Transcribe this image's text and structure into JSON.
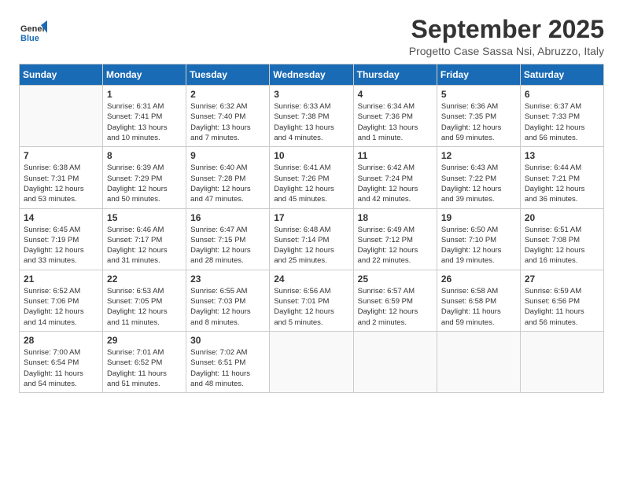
{
  "header": {
    "logo_line1": "General",
    "logo_line2": "Blue",
    "month": "September 2025",
    "location": "Progetto Case Sassa Nsi, Abruzzo, Italy"
  },
  "weekdays": [
    "Sunday",
    "Monday",
    "Tuesday",
    "Wednesday",
    "Thursday",
    "Friday",
    "Saturday"
  ],
  "weeks": [
    [
      {
        "day": "",
        "text": ""
      },
      {
        "day": "1",
        "text": "Sunrise: 6:31 AM\nSunset: 7:41 PM\nDaylight: 13 hours\nand 10 minutes."
      },
      {
        "day": "2",
        "text": "Sunrise: 6:32 AM\nSunset: 7:40 PM\nDaylight: 13 hours\nand 7 minutes."
      },
      {
        "day": "3",
        "text": "Sunrise: 6:33 AM\nSunset: 7:38 PM\nDaylight: 13 hours\nand 4 minutes."
      },
      {
        "day": "4",
        "text": "Sunrise: 6:34 AM\nSunset: 7:36 PM\nDaylight: 13 hours\nand 1 minute."
      },
      {
        "day": "5",
        "text": "Sunrise: 6:36 AM\nSunset: 7:35 PM\nDaylight: 12 hours\nand 59 minutes."
      },
      {
        "day": "6",
        "text": "Sunrise: 6:37 AM\nSunset: 7:33 PM\nDaylight: 12 hours\nand 56 minutes."
      }
    ],
    [
      {
        "day": "7",
        "text": "Sunrise: 6:38 AM\nSunset: 7:31 PM\nDaylight: 12 hours\nand 53 minutes."
      },
      {
        "day": "8",
        "text": "Sunrise: 6:39 AM\nSunset: 7:29 PM\nDaylight: 12 hours\nand 50 minutes."
      },
      {
        "day": "9",
        "text": "Sunrise: 6:40 AM\nSunset: 7:28 PM\nDaylight: 12 hours\nand 47 minutes."
      },
      {
        "day": "10",
        "text": "Sunrise: 6:41 AM\nSunset: 7:26 PM\nDaylight: 12 hours\nand 45 minutes."
      },
      {
        "day": "11",
        "text": "Sunrise: 6:42 AM\nSunset: 7:24 PM\nDaylight: 12 hours\nand 42 minutes."
      },
      {
        "day": "12",
        "text": "Sunrise: 6:43 AM\nSunset: 7:22 PM\nDaylight: 12 hours\nand 39 minutes."
      },
      {
        "day": "13",
        "text": "Sunrise: 6:44 AM\nSunset: 7:21 PM\nDaylight: 12 hours\nand 36 minutes."
      }
    ],
    [
      {
        "day": "14",
        "text": "Sunrise: 6:45 AM\nSunset: 7:19 PM\nDaylight: 12 hours\nand 33 minutes."
      },
      {
        "day": "15",
        "text": "Sunrise: 6:46 AM\nSunset: 7:17 PM\nDaylight: 12 hours\nand 31 minutes."
      },
      {
        "day": "16",
        "text": "Sunrise: 6:47 AM\nSunset: 7:15 PM\nDaylight: 12 hours\nand 28 minutes."
      },
      {
        "day": "17",
        "text": "Sunrise: 6:48 AM\nSunset: 7:14 PM\nDaylight: 12 hours\nand 25 minutes."
      },
      {
        "day": "18",
        "text": "Sunrise: 6:49 AM\nSunset: 7:12 PM\nDaylight: 12 hours\nand 22 minutes."
      },
      {
        "day": "19",
        "text": "Sunrise: 6:50 AM\nSunset: 7:10 PM\nDaylight: 12 hours\nand 19 minutes."
      },
      {
        "day": "20",
        "text": "Sunrise: 6:51 AM\nSunset: 7:08 PM\nDaylight: 12 hours\nand 16 minutes."
      }
    ],
    [
      {
        "day": "21",
        "text": "Sunrise: 6:52 AM\nSunset: 7:06 PM\nDaylight: 12 hours\nand 14 minutes."
      },
      {
        "day": "22",
        "text": "Sunrise: 6:53 AM\nSunset: 7:05 PM\nDaylight: 12 hours\nand 11 minutes."
      },
      {
        "day": "23",
        "text": "Sunrise: 6:55 AM\nSunset: 7:03 PM\nDaylight: 12 hours\nand 8 minutes."
      },
      {
        "day": "24",
        "text": "Sunrise: 6:56 AM\nSunset: 7:01 PM\nDaylight: 12 hours\nand 5 minutes."
      },
      {
        "day": "25",
        "text": "Sunrise: 6:57 AM\nSunset: 6:59 PM\nDaylight: 12 hours\nand 2 minutes."
      },
      {
        "day": "26",
        "text": "Sunrise: 6:58 AM\nSunset: 6:58 PM\nDaylight: 11 hours\nand 59 minutes."
      },
      {
        "day": "27",
        "text": "Sunrise: 6:59 AM\nSunset: 6:56 PM\nDaylight: 11 hours\nand 56 minutes."
      }
    ],
    [
      {
        "day": "28",
        "text": "Sunrise: 7:00 AM\nSunset: 6:54 PM\nDaylight: 11 hours\nand 54 minutes."
      },
      {
        "day": "29",
        "text": "Sunrise: 7:01 AM\nSunset: 6:52 PM\nDaylight: 11 hours\nand 51 minutes."
      },
      {
        "day": "30",
        "text": "Sunrise: 7:02 AM\nSunset: 6:51 PM\nDaylight: 11 hours\nand 48 minutes."
      },
      {
        "day": "",
        "text": ""
      },
      {
        "day": "",
        "text": ""
      },
      {
        "day": "",
        "text": ""
      },
      {
        "day": "",
        "text": ""
      }
    ]
  ]
}
